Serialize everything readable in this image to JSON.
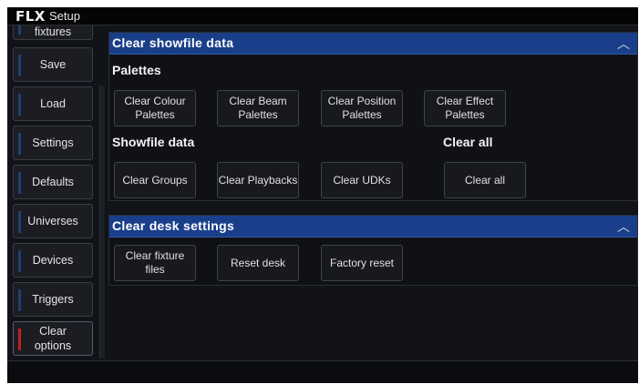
{
  "titlebar": {
    "logo": "FLX",
    "title": "Setup"
  },
  "sidebar": {
    "items": [
      {
        "label": "fixtures"
      },
      {
        "label": "Save"
      },
      {
        "label": "Load"
      },
      {
        "label": "Settings"
      },
      {
        "label": "Defaults"
      },
      {
        "label": "Universes"
      },
      {
        "label": "Devices"
      },
      {
        "label": "Triggers"
      },
      {
        "label": "Clear\noptions",
        "active": true
      }
    ]
  },
  "showfile_panel": {
    "title": "Clear showfile data",
    "palettes_label": "Palettes",
    "showfile_label": "Showfile data",
    "clearall_label": "Clear all",
    "buttons": {
      "clear_colour": "Clear Colour Palettes",
      "clear_beam": "Clear Beam Palettes",
      "clear_position": "Clear Position Palettes",
      "clear_effect": "Clear Effect Palettes",
      "clear_groups": "Clear Groups",
      "clear_playbacks": "Clear Playbacks",
      "clear_udks": "Clear UDKs",
      "clear_all": "Clear all"
    }
  },
  "desk_panel": {
    "title": "Clear desk settings",
    "buttons": {
      "clear_fixture_files": "Clear fixture files",
      "reset_desk": "Reset desk",
      "factory_reset": "Factory reset"
    }
  },
  "icons": {
    "collapse": "chevron-up-icon"
  },
  "colors": {
    "header_blue": "#1a3f8a",
    "active_marker": "#c02020",
    "inactive_marker": "#1e3f73"
  }
}
